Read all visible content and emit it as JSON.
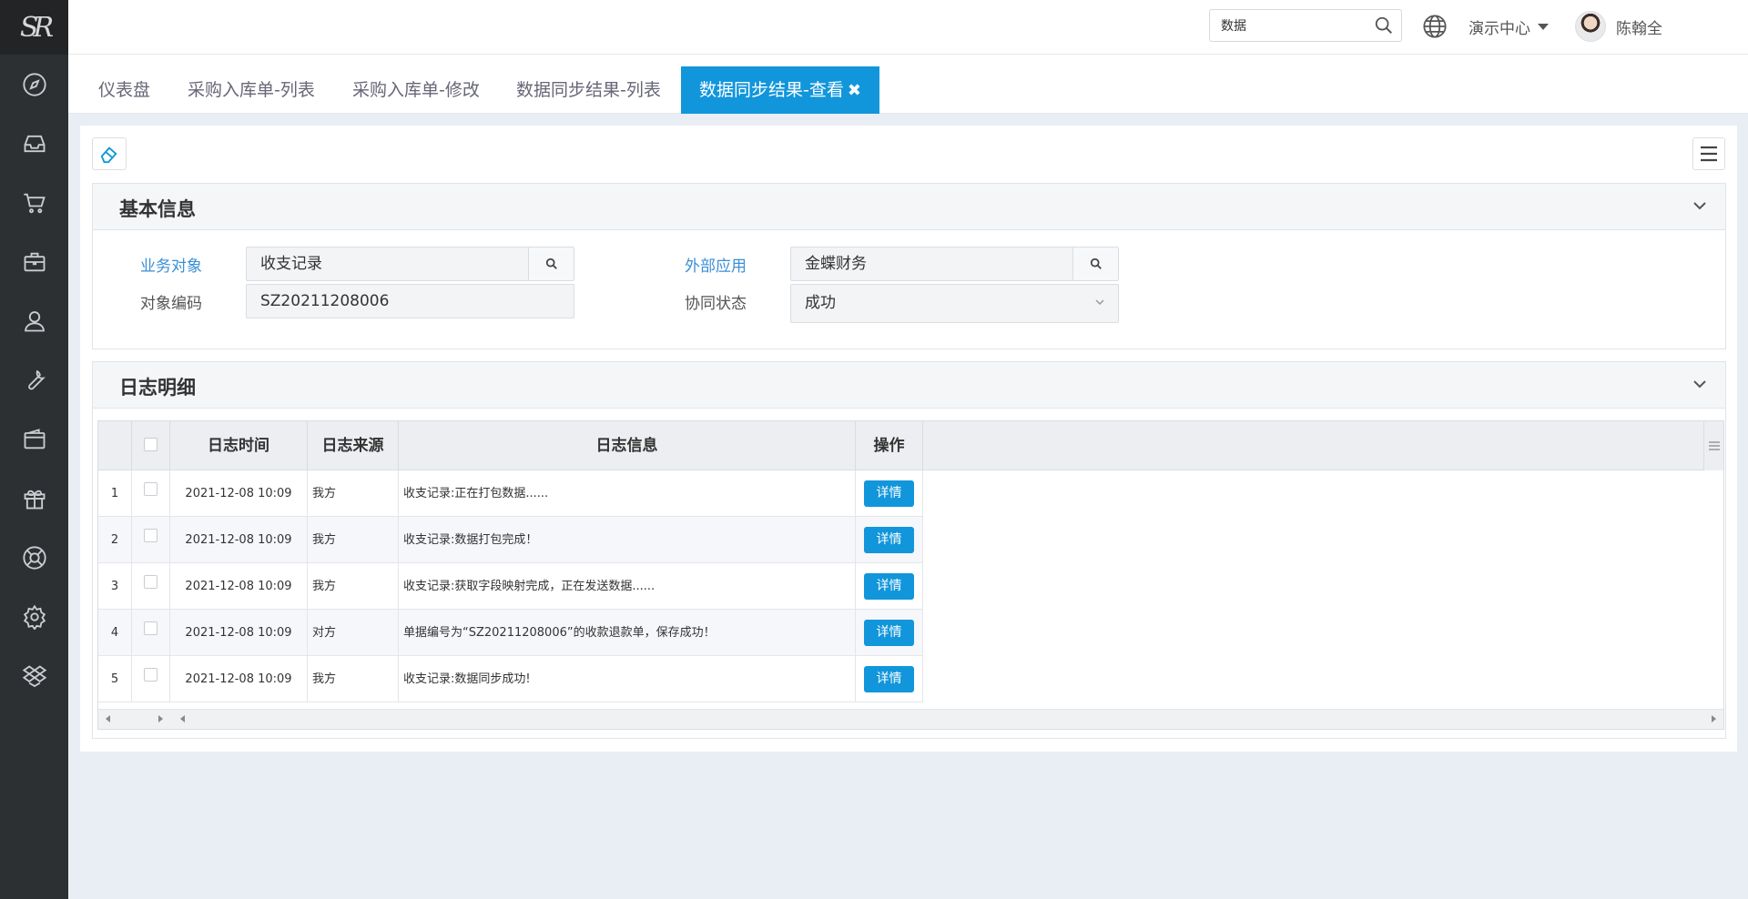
{
  "app": {
    "logo_text": "SR"
  },
  "sidebar": {
    "items": [
      {
        "icon": "compass-icon"
      },
      {
        "icon": "inbox-icon"
      },
      {
        "icon": "cart-icon"
      },
      {
        "icon": "briefcase-icon"
      },
      {
        "icon": "user-icon"
      },
      {
        "icon": "wrench-icon"
      },
      {
        "icon": "wallet-icon"
      },
      {
        "icon": "gift-icon"
      },
      {
        "icon": "lifebuoy-icon"
      },
      {
        "icon": "gear-icon"
      },
      {
        "icon": "dropbox-icon"
      }
    ]
  },
  "header": {
    "search_value": "数据",
    "center": "演示中心",
    "user_name": "陈翰全",
    "help": "?"
  },
  "tabs": [
    {
      "label": "仪表盘"
    },
    {
      "label": "采购入库单-列表"
    },
    {
      "label": "采购入库单-修改"
    },
    {
      "label": "数据同步结果-列表"
    },
    {
      "label": "数据同步结果-查看",
      "active": true,
      "close": "✖"
    }
  ],
  "basic_info": {
    "title": "基本信息",
    "business_object_label": "业务对象",
    "business_object_value": "收支记录",
    "object_code_label": "对象编码",
    "object_code_value": "SZ20211208006",
    "external_app_label": "外部应用",
    "external_app_value": "金蝶财务",
    "sync_status_label": "协同状态",
    "sync_status_value": "成功"
  },
  "log_detail": {
    "title": "日志明细",
    "columns": [
      "日志时间",
      "日志来源",
      "日志信息",
      "操作"
    ],
    "rows": [
      {
        "no": "1",
        "time": "2021-12-08 10:09",
        "source": "我方",
        "message": "收支记录:正在打包数据......",
        "action": "详情"
      },
      {
        "no": "2",
        "time": "2021-12-08 10:09",
        "source": "我方",
        "message": "收支记录:数据打包完成！",
        "action": "详情"
      },
      {
        "no": "3",
        "time": "2021-12-08 10:09",
        "source": "我方",
        "message": "收支记录:获取字段映射完成，正在发送数据......",
        "action": "详情"
      },
      {
        "no": "4",
        "time": "2021-12-08 10:09",
        "source": "对方",
        "message": "单据编号为“SZ20211208006”的收款退款单，保存成功！",
        "action": "详情"
      },
      {
        "no": "5",
        "time": "2021-12-08 10:09",
        "source": "我方",
        "message": "收支记录:数据同步成功!",
        "action": "详情"
      }
    ]
  },
  "colors": {
    "accent": "#1296db",
    "sidebar_bg": "#2d3033",
    "link": "#3a8fd6"
  }
}
